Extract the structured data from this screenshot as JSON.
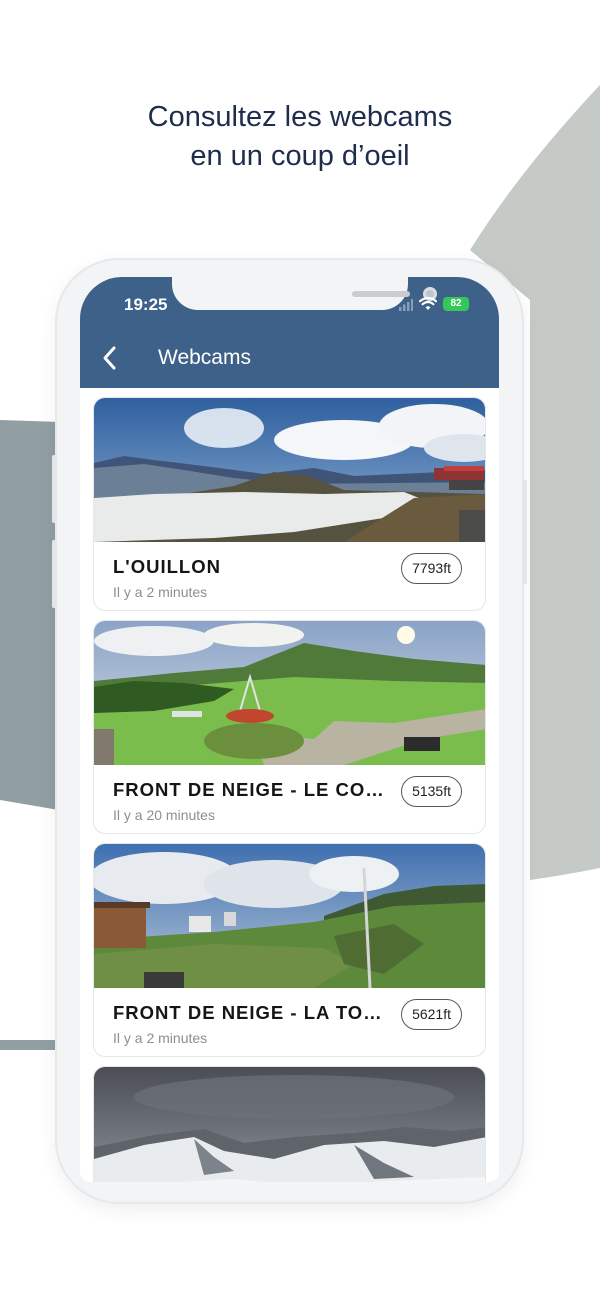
{
  "headline": {
    "line1": "Consultez les webcams",
    "line2": "en un coup d’oeil"
  },
  "colors": {
    "header": "#3e6189",
    "headline": "#1f2d4d",
    "background_shape_left": "#919fa5",
    "background_shape_right": "#c5cac6",
    "battery": "#35c759"
  },
  "status_bar": {
    "time": "19:25",
    "battery": "82",
    "icons": [
      "signal-icon",
      "wifi-icon",
      "battery-icon"
    ]
  },
  "nav": {
    "back_icon": "chevron-left-icon",
    "title": "Webcams"
  },
  "webcams": [
    {
      "name": "L'OUILLON",
      "updated": "Il y a 2 minutes",
      "altitude": "7793ft",
      "scene": "alpine-summit-snow"
    },
    {
      "name": "FRONT DE NEIGE - LE CORBIER",
      "updated": "Il y a 20 minutes",
      "altitude": "5135ft",
      "scene": "green-meadow-summer"
    },
    {
      "name": "FRONT DE NEIGE - LA TOUSSUIRE",
      "updated": "Il y a 2 minutes",
      "altitude": "5621ft",
      "scene": "resort-village-summer"
    },
    {
      "name": "",
      "updated": "",
      "altitude": "",
      "scene": "snowy-peaks-cloudy"
    }
  ]
}
